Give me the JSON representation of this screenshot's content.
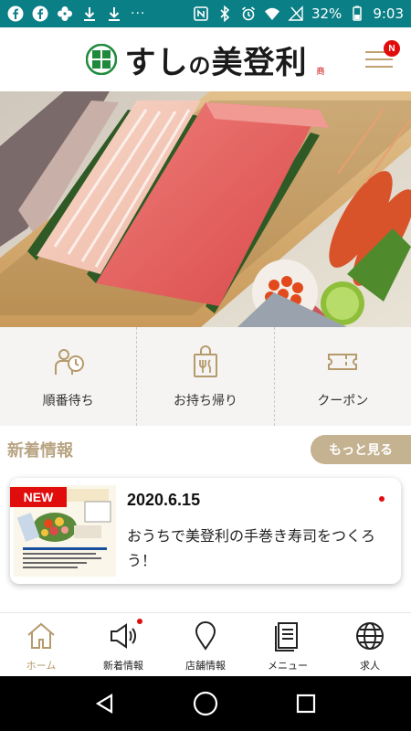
{
  "status_bar": {
    "battery": "32%",
    "time": "9:03"
  },
  "header": {
    "logo_text_main": "すし",
    "logo_text_small": "の",
    "logo_text_tail": "美登利",
    "logo_reg": "商",
    "menu_badge": "N"
  },
  "quick_actions": [
    {
      "label": "順番待ち",
      "icon": "queue-wait-icon"
    },
    {
      "label": "お持ち帰り",
      "icon": "takeout-bag-icon"
    },
    {
      "label": "クーポン",
      "icon": "coupon-ticket-icon"
    }
  ],
  "news": {
    "title": "新着情報",
    "more_label": "もっと見る",
    "items": [
      {
        "badge": "NEW",
        "date": "2020.6.15",
        "text": "おうちで美登利の手巻き寿司をつくろう！"
      }
    ]
  },
  "tabbar": [
    {
      "label": "ホーム",
      "icon": "home-icon"
    },
    {
      "label": "新着情報",
      "icon": "megaphone-icon"
    },
    {
      "label": "店舗情報",
      "icon": "map-pin-icon"
    },
    {
      "label": "メニュー",
      "icon": "menu-book-icon"
    },
    {
      "label": "求人",
      "icon": "globe-icon"
    }
  ],
  "colors": {
    "status_bar": "#0a7f86",
    "accent_gold": "#c4b291",
    "badge_red": "#e10c0c"
  }
}
